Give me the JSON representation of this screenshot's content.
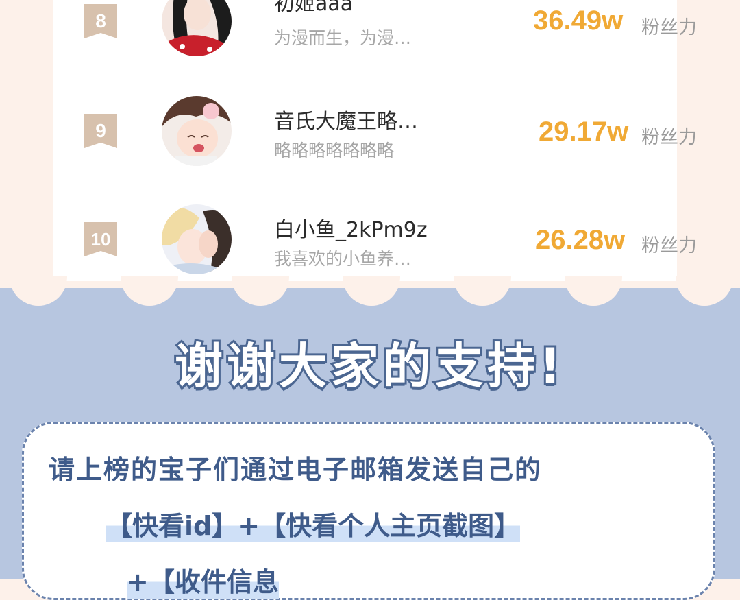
{
  "ranking": [
    {
      "rank": "8",
      "name": "初姬aaa",
      "bio": "为漫而生，为漫…",
      "score": "36.49w",
      "unit": "粉丝力"
    },
    {
      "rank": "9",
      "name": "音氏大魔王略…",
      "bio": "略略略略略略略",
      "score": "29.17w",
      "unit": "粉丝力"
    },
    {
      "rank": "10",
      "name": "白小鱼_2kPm9z",
      "bio": "我喜欢的小鱼养…",
      "score": "26.28w",
      "unit": "粉丝力"
    }
  ],
  "thanks_banner": "谢谢大家的支持!",
  "notice": {
    "line1": "请上榜的宝子们通过电子邮箱发送自己的",
    "line2": "【快看id】+【快看个人主页截图】",
    "line3": "+【收件信息"
  },
  "colors": {
    "score": "#f0a935",
    "rank_badge": "#d7c1ad",
    "bottom_bg": "#b7c6e0",
    "accent_text": "#3f5b8a"
  }
}
